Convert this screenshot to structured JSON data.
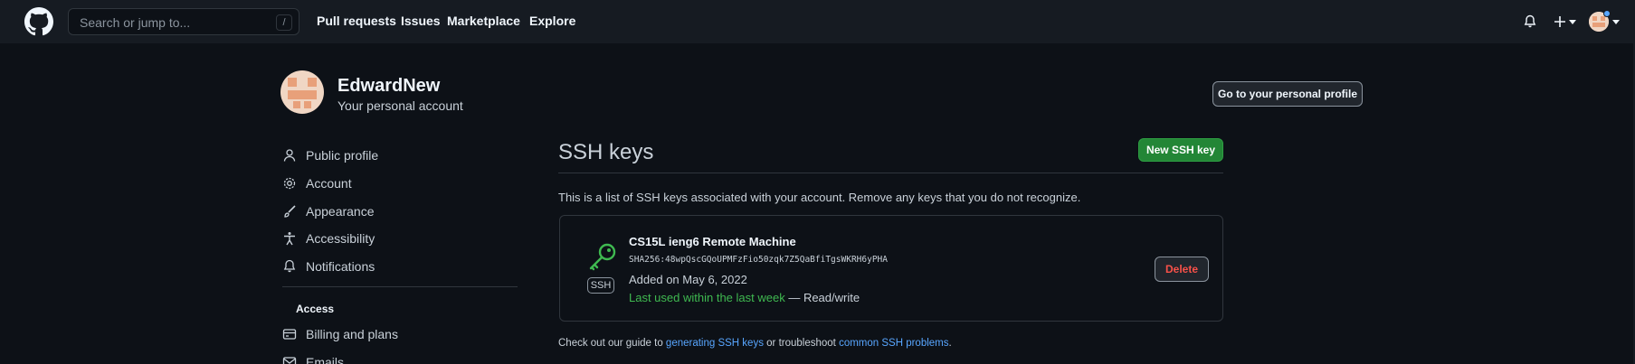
{
  "header": {
    "search_placeholder": "Search or jump to...",
    "search_shortcut": "/",
    "nav": [
      "Pull requests",
      "Issues",
      "Marketplace",
      "Explore"
    ]
  },
  "profile": {
    "username": "EdwardNew",
    "subtitle": "Your personal account",
    "profile_button": "Go to your personal profile"
  },
  "sidebar": {
    "items": [
      {
        "label": "Public profile",
        "icon": "person-icon"
      },
      {
        "label": "Account",
        "icon": "gear-icon"
      },
      {
        "label": "Appearance",
        "icon": "paintbrush-icon"
      },
      {
        "label": "Accessibility",
        "icon": "accessibility-icon"
      },
      {
        "label": "Notifications",
        "icon": "bell-icon"
      }
    ],
    "access_heading": "Access",
    "access_items": [
      {
        "label": "Billing and plans",
        "icon": "credit-card-icon"
      },
      {
        "label": "Emails",
        "icon": "mail-icon"
      }
    ]
  },
  "main": {
    "title": "SSH keys",
    "new_button": "New SSH key",
    "description": "This is a list of SSH keys associated with your account. Remove any keys that you do not recognize.",
    "keys": [
      {
        "badge": "SSH",
        "title": "CS15L ieng6 Remote Machine",
        "fingerprint": "SHA256:48wpQscGQoUPMFzFio50zqk7Z5QaBfiTgsWKRH6yPHA",
        "added": "Added on May 6, 2022",
        "last_used": "Last used within the last week",
        "access": " — Read/write",
        "delete_label": "Delete"
      }
    ],
    "footer": {
      "prefix": "Check out our guide to ",
      "link1": "generating SSH keys",
      "middle": " or troubleshoot ",
      "link2": "common SSH problems",
      "suffix": "."
    }
  },
  "colors": {
    "background": "#0d1117",
    "header": "#161b22",
    "accent_green": "#238636",
    "link": "#58a6ff",
    "danger": "#f85149",
    "last_used": "#3fb950"
  }
}
